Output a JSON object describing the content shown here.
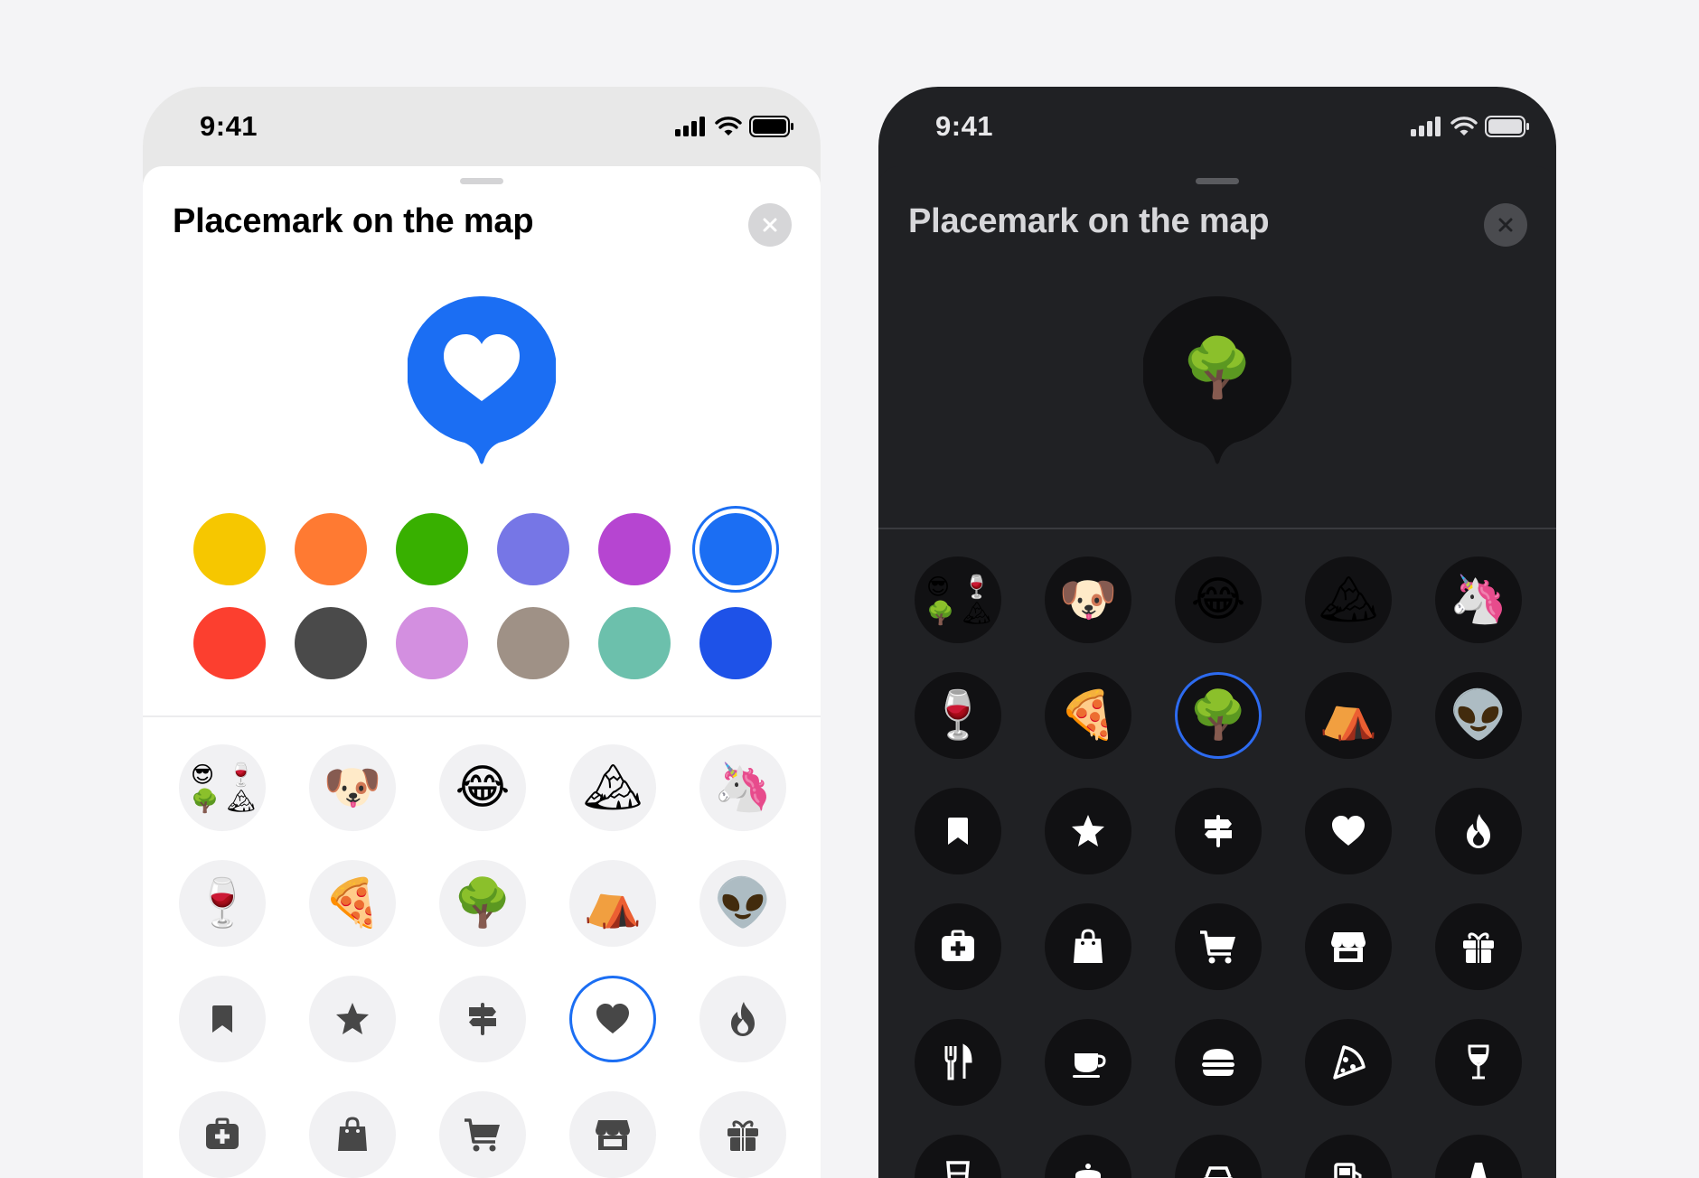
{
  "light": {
    "status_time": "9:41",
    "title": "Placemark on the map",
    "pin_color": "#1b6ef3",
    "pin_icon": "heart-icon",
    "colors": [
      "#f6c700",
      "#ff7a32",
      "#38b000",
      "#7676e6",
      "#b645d1",
      "#1b6ef3",
      "#fc3f2f",
      "#4a4a4a",
      "#d38fe0",
      "#9f9186",
      "#6cc0ac",
      "#1e52e8"
    ],
    "selected_color": "#1b6ef3",
    "icons": [
      {
        "name": "emoji-combo",
        "emoji": "😎🍷🌳🏔"
      },
      {
        "name": "dog-emoji",
        "emoji": "🐶"
      },
      {
        "name": "laughing-emoji",
        "emoji": "😂"
      },
      {
        "name": "mountain-emoji",
        "emoji": "🏔"
      },
      {
        "name": "unicorn-emoji",
        "emoji": "🦄"
      },
      {
        "name": "wine-emoji",
        "emoji": "🍷"
      },
      {
        "name": "pizza-emoji",
        "emoji": "🍕"
      },
      {
        "name": "tree-emoji",
        "emoji": "🌳"
      },
      {
        "name": "tent-emoji",
        "emoji": "⛺"
      },
      {
        "name": "alien-emoji",
        "emoji": "👽"
      },
      {
        "name": "bookmark-icon"
      },
      {
        "name": "star-icon"
      },
      {
        "name": "signpost-icon"
      },
      {
        "name": "heart-icon",
        "selected": true
      },
      {
        "name": "fire-icon"
      },
      {
        "name": "first-aid-icon"
      },
      {
        "name": "shopping-bag-icon"
      },
      {
        "name": "cart-icon"
      },
      {
        "name": "store-icon"
      },
      {
        "name": "gift-icon"
      }
    ]
  },
  "dark": {
    "status_time": "9:41",
    "title": "Placemark on the map",
    "pin_color": "#111113",
    "pin_icon": "tree-emoji",
    "pin_emoji": "🌳",
    "icons": [
      {
        "name": "emoji-combo",
        "emoji": "😎🍷🌳🏔"
      },
      {
        "name": "dog-emoji",
        "emoji": "🐶"
      },
      {
        "name": "laughing-emoji",
        "emoji": "😂"
      },
      {
        "name": "mountain-emoji",
        "emoji": "🏔"
      },
      {
        "name": "unicorn-emoji",
        "emoji": "🦄"
      },
      {
        "name": "wine-emoji",
        "emoji": "🍷"
      },
      {
        "name": "pizza-emoji",
        "emoji": "🍕"
      },
      {
        "name": "tree-emoji",
        "emoji": "🌳",
        "selected": true
      },
      {
        "name": "tent-emoji",
        "emoji": "⛺"
      },
      {
        "name": "alien-emoji",
        "emoji": "👽"
      },
      {
        "name": "bookmark-icon"
      },
      {
        "name": "star-icon"
      },
      {
        "name": "signpost-icon"
      },
      {
        "name": "heart-icon"
      },
      {
        "name": "fire-icon"
      },
      {
        "name": "first-aid-icon"
      },
      {
        "name": "shopping-bag-icon"
      },
      {
        "name": "cart-icon"
      },
      {
        "name": "store-icon"
      },
      {
        "name": "gift-icon"
      },
      {
        "name": "fork-knife-icon"
      },
      {
        "name": "coffee-cup-icon"
      },
      {
        "name": "burger-icon"
      },
      {
        "name": "pizza-slice-icon"
      },
      {
        "name": "wine-glass-icon"
      },
      {
        "name": "glass-icon"
      },
      {
        "name": "teapot-icon"
      },
      {
        "name": "car-icon"
      },
      {
        "name": "gas-station-icon"
      },
      {
        "name": "cone-icon"
      }
    ]
  }
}
